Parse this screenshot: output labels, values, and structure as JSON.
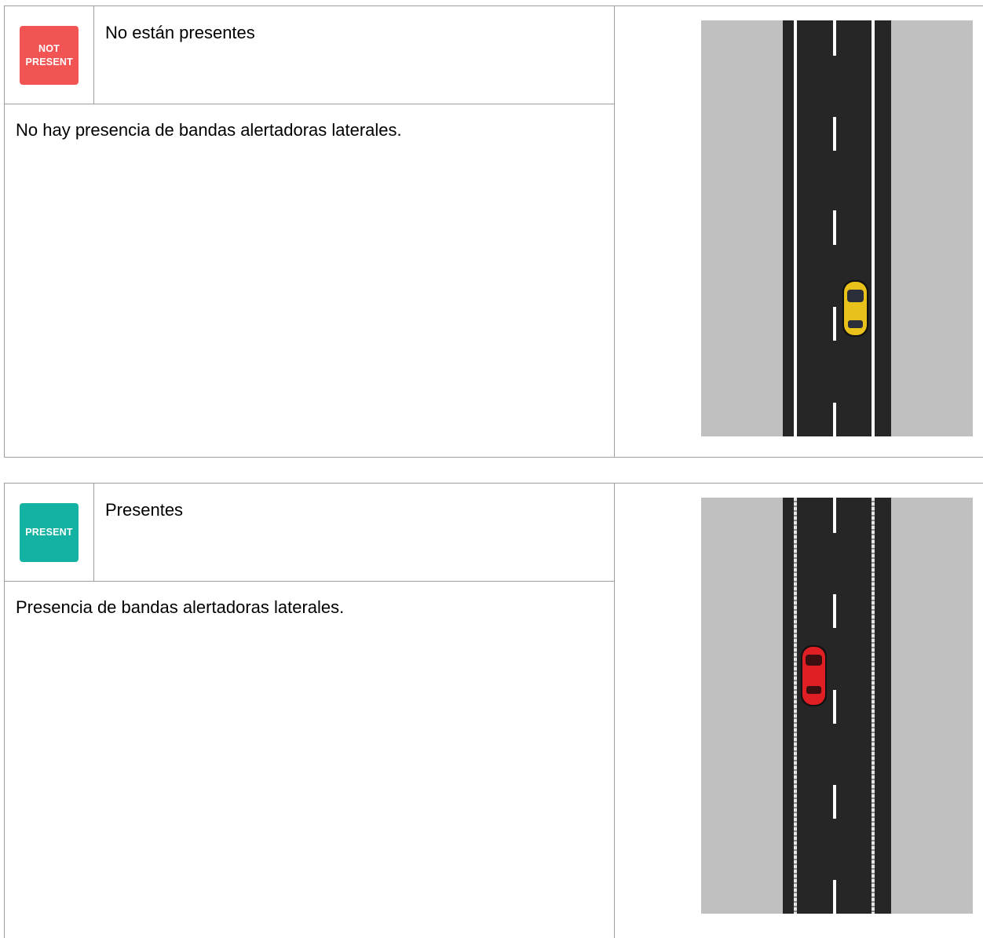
{
  "sections": [
    {
      "badge_text": "NOT PRESENT",
      "badge_color": "#f25454",
      "title": "No están presentes",
      "description": "No hay presencia de bandas alertadoras laterales.",
      "car_color": "#e8c21a",
      "edge_line_style": "solid"
    },
    {
      "badge_text": "PRESENT",
      "badge_color": "#14b2a2",
      "title": "Presentes",
      "description": "Presencia de bandas alertadoras laterales.",
      "car_color": "#e01f24",
      "edge_line_style": "rumble-strip"
    }
  ]
}
